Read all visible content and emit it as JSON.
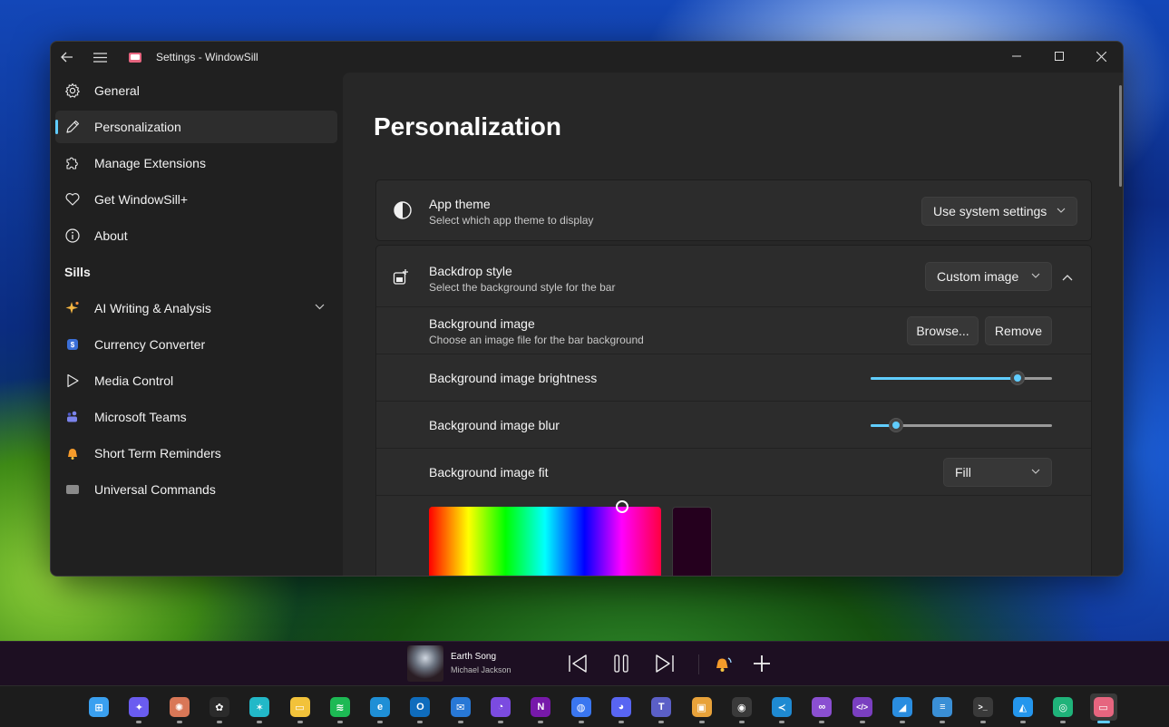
{
  "window": {
    "title": "Settings - WindowSill"
  },
  "sidebar": {
    "items": [
      {
        "label": "General",
        "icon": "gear-icon"
      },
      {
        "label": "Personalization",
        "icon": "pen-icon",
        "active": true
      },
      {
        "label": "Manage Extensions",
        "icon": "puzzle-icon"
      },
      {
        "label": "Get WindowSill+",
        "icon": "heart-icon"
      },
      {
        "label": "About",
        "icon": "info-icon"
      }
    ],
    "sills_heading": "Sills",
    "sills": [
      {
        "label": "AI Writing & Analysis",
        "icon": "sparkle-icon",
        "color": "#f5b642",
        "expandable": true
      },
      {
        "label": "Currency Converter",
        "icon": "currency-icon",
        "color": "#3b6fd8"
      },
      {
        "label": "Media Control",
        "icon": "play-icon",
        "color": "#e8e8e8"
      },
      {
        "label": "Microsoft Teams",
        "icon": "teams-icon",
        "color": "#7b83eb"
      },
      {
        "label": "Short Term Reminders",
        "icon": "bell-icon",
        "color": "#f59b2b"
      },
      {
        "label": "Universal Commands",
        "icon": "command-icon",
        "color": "#8a8a8a"
      }
    ]
  },
  "content": {
    "title": "Personalization",
    "app_theme": {
      "title": "App theme",
      "subtitle": "Select which app theme to display",
      "value": "Use system settings"
    },
    "backdrop": {
      "title": "Backdrop style",
      "subtitle": "Select the background style for the bar",
      "value": "Custom image"
    },
    "bg_image": {
      "title": "Background image",
      "subtitle": "Choose an image file for the bar background",
      "browse_label": "Browse...",
      "remove_label": "Remove"
    },
    "brightness": {
      "title": "Background image brightness",
      "value": 0.81
    },
    "blur": {
      "title": "Background image blur",
      "value": 0.14
    },
    "fit": {
      "title": "Background image fit",
      "value": "Fill"
    },
    "accent": "#60cdff"
  },
  "sillbar": {
    "song": "Earth Song",
    "artist": "Michael Jackson"
  },
  "taskbar": {
    "apps": [
      {
        "name": "start",
        "glyph": "⊞",
        "color": "#3aa0f0"
      },
      {
        "name": "copilot",
        "glyph": "✦",
        "color": "#6a5cf0"
      },
      {
        "name": "claude",
        "glyph": "✺",
        "color": "#d97757"
      },
      {
        "name": "chatgpt",
        "glyph": "✿",
        "color": "#2b2b2b"
      },
      {
        "name": "butterfly",
        "glyph": "✶",
        "color": "#22b8c8"
      },
      {
        "name": "file-explorer",
        "glyph": "▭",
        "color": "#f2c23a"
      },
      {
        "name": "spotify",
        "glyph": "≋",
        "color": "#1db954"
      },
      {
        "name": "edge",
        "glyph": "e",
        "color": "#1f8fd6"
      },
      {
        "name": "outlook",
        "glyph": "O",
        "color": "#0f6cbd"
      },
      {
        "name": "mail",
        "glyph": "✉",
        "color": "#2878d6"
      },
      {
        "name": "app-purple",
        "glyph": "◔",
        "color": "#7b4be0"
      },
      {
        "name": "onenote",
        "glyph": "N",
        "color": "#7719aa"
      },
      {
        "name": "signal",
        "glyph": "◍",
        "color": "#3a76f0"
      },
      {
        "name": "discord",
        "glyph": "◕",
        "color": "#5865f2"
      },
      {
        "name": "teams",
        "glyph": "T",
        "color": "#5b5fc7"
      },
      {
        "name": "remote",
        "glyph": "▣",
        "color": "#e8a23a"
      },
      {
        "name": "github",
        "glyph": "◉",
        "color": "#3a3a3a"
      },
      {
        "name": "vscode",
        "glyph": "≺",
        "color": "#1f8ad2"
      },
      {
        "name": "visual-studio",
        "glyph": "∞",
        "color": "#8a4fd1"
      },
      {
        "name": "devtools",
        "glyph": "</>",
        "color": "#7a3fc0"
      },
      {
        "name": "azure",
        "glyph": "◢",
        "color": "#2a8de0"
      },
      {
        "name": "notepad",
        "glyph": "≡",
        "color": "#3a8fd6"
      },
      {
        "name": "terminal",
        "glyph": ">_",
        "color": "#3a3a3a"
      },
      {
        "name": "docker",
        "glyph": "◭",
        "color": "#2496ed"
      },
      {
        "name": "app-green",
        "glyph": "◎",
        "color": "#1fb37a"
      },
      {
        "name": "windowsill",
        "glyph": "▭",
        "color": "#e6657f",
        "active": true
      }
    ]
  }
}
